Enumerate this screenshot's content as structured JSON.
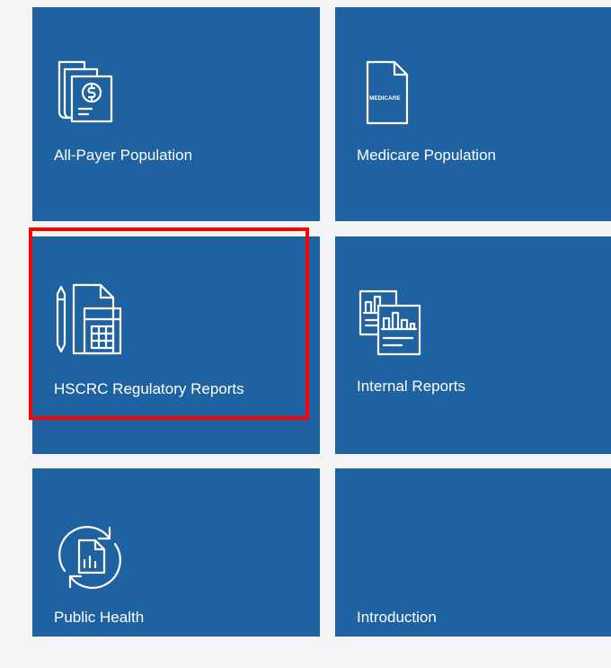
{
  "tiles": [
    {
      "label": "All-Payer Population",
      "icon": "payer-document-dollar-icon"
    },
    {
      "label": "Medicare Population",
      "icon": "medicare-document-icon",
      "icon_text": "MEDICARE"
    },
    {
      "label": "HSCRC Regulatory Reports",
      "icon": "pencil-calculator-document-icon"
    },
    {
      "label": "Internal Reports",
      "icon": "chart-reports-icon"
    },
    {
      "label": "Public Health",
      "icon": "refresh-document-chart-icon"
    },
    {
      "label": "Introduction",
      "icon": ""
    }
  ],
  "colors": {
    "tile": "#1f62a1",
    "background": "#f3f4f6",
    "highlight": "#ff0000"
  }
}
